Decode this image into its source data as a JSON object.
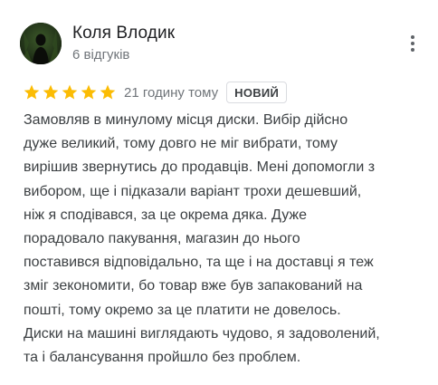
{
  "review": {
    "author": {
      "name": "Коля Влодик",
      "reviews_count": "6 відгуків",
      "avatar_icon": "user-avatar-photo"
    },
    "rating": 5,
    "max_rating": 5,
    "star_color": "#fbbc04",
    "time": "21 годину тому",
    "badge": "НОВИЙ",
    "menu_icon": "more-vert-icon",
    "text_lines": [
      "Замовляв в минулому місця диски. Вибір дійсно",
      "дуже великий, тому довго не міг вибрати, тому",
      "вирішив звернутись до продавців. Мені допомогли з",
      "вибором, ще і підказали варіант трохи дешевший,",
      "ніж я сподівався, за це окрема дяка. Дуже",
      "порадовало пакування, магазин до нього",
      "поставився відповідально, та ще і на доставці я теж",
      "зміг зекономити, бо товар вже був запакований на",
      "пошті, тому окремо за це платити не довелось.",
      "Диски на машині виглядають чудово, я задоволений,",
      "та і балансування пройшло без проблем."
    ]
  }
}
